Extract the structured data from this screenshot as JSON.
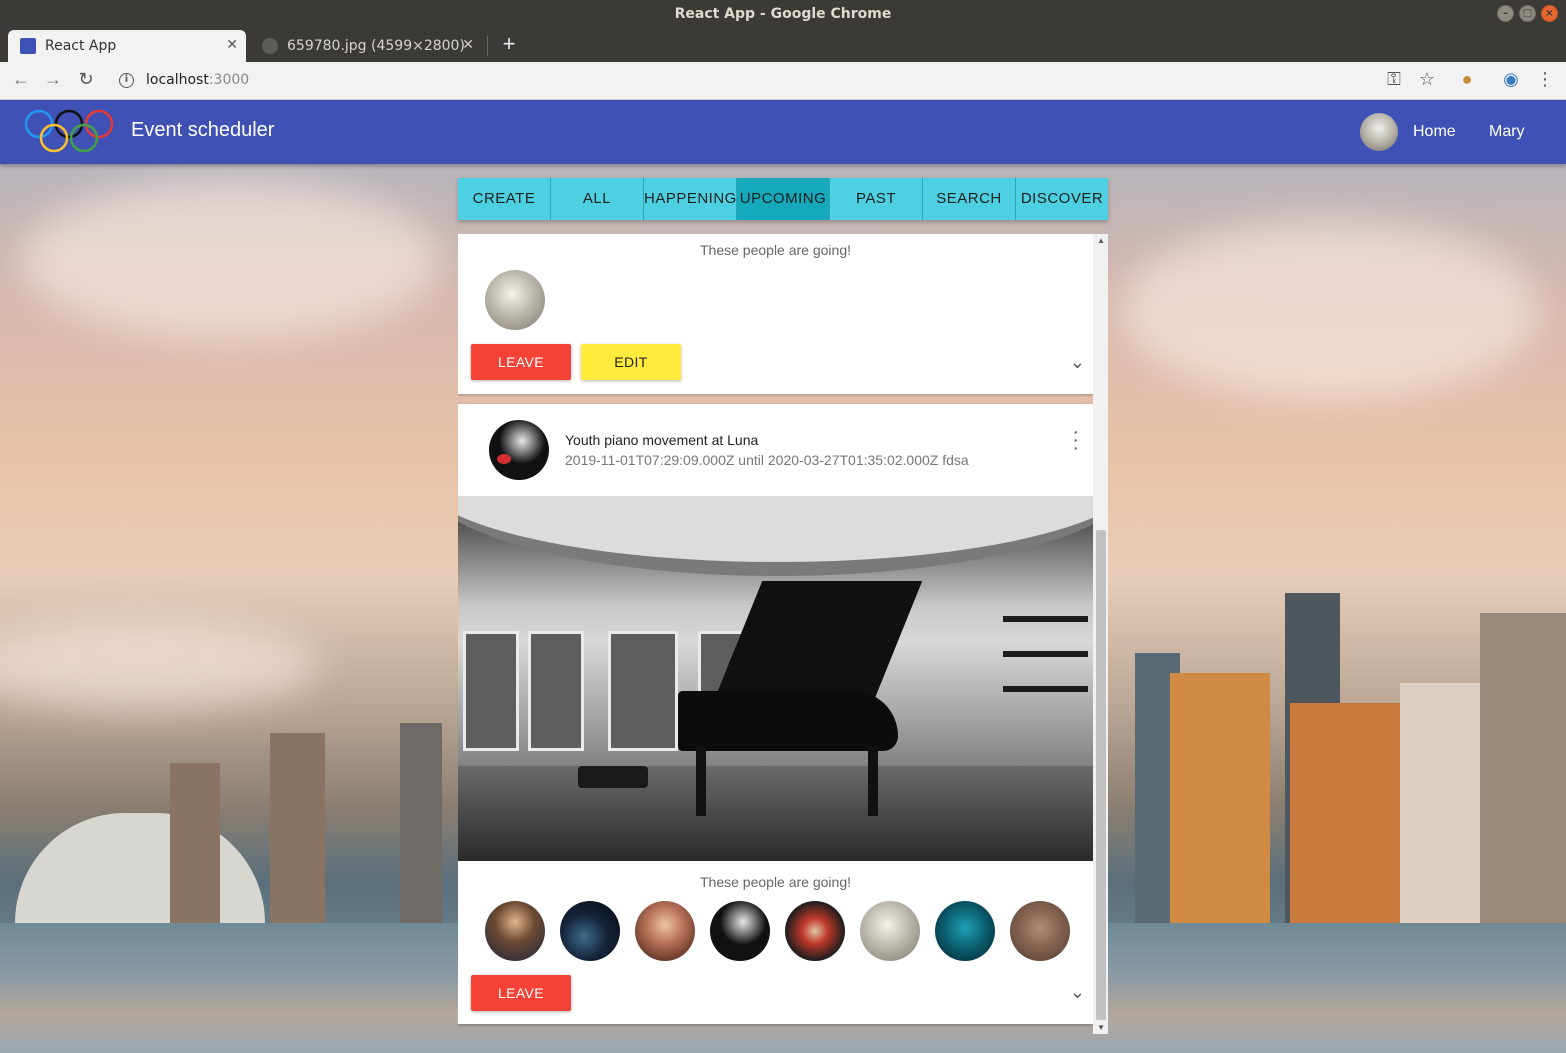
{
  "window": {
    "title": "React App - Google Chrome"
  },
  "browser": {
    "tabs": [
      {
        "label": "React App",
        "active": true
      },
      {
        "label": "659780.jpg (4599×2800)",
        "active": false
      }
    ],
    "url_host": "localhost",
    "url_port": ":3000"
  },
  "appbar": {
    "title": "Event scheduler",
    "nav": [
      "Home",
      "Mary"
    ]
  },
  "event_tabs": [
    {
      "label": "CREATE",
      "selected": false
    },
    {
      "label": "ALL",
      "selected": false
    },
    {
      "label": "HAPPENING",
      "selected": false
    },
    {
      "label": "UPCOMING",
      "selected": true
    },
    {
      "label": "PAST",
      "selected": false
    },
    {
      "label": "SEARCH",
      "selected": false
    },
    {
      "label": "DISCOVER",
      "selected": false
    }
  ],
  "cards": [
    {
      "going_title": "These people are going!",
      "attendee_count": 1,
      "buttons": {
        "leave": "LEAVE",
        "edit": "EDIT"
      }
    },
    {
      "name": "Youth piano movement at Luna",
      "subtitle": "2019-11-01T07:29:09.000Z until 2020-03-27T01:35:02.000Z fdsa",
      "going_title": "These people are going!",
      "attendee_count": 8,
      "buttons": {
        "leave": "LEAVE"
      }
    }
  ],
  "colors": {
    "appbar": "#3f51b5",
    "tab": "#4dd0e1",
    "tab_selected": "#16a9bb",
    "leave": "#f44336",
    "edit": "#ffeb3b"
  }
}
